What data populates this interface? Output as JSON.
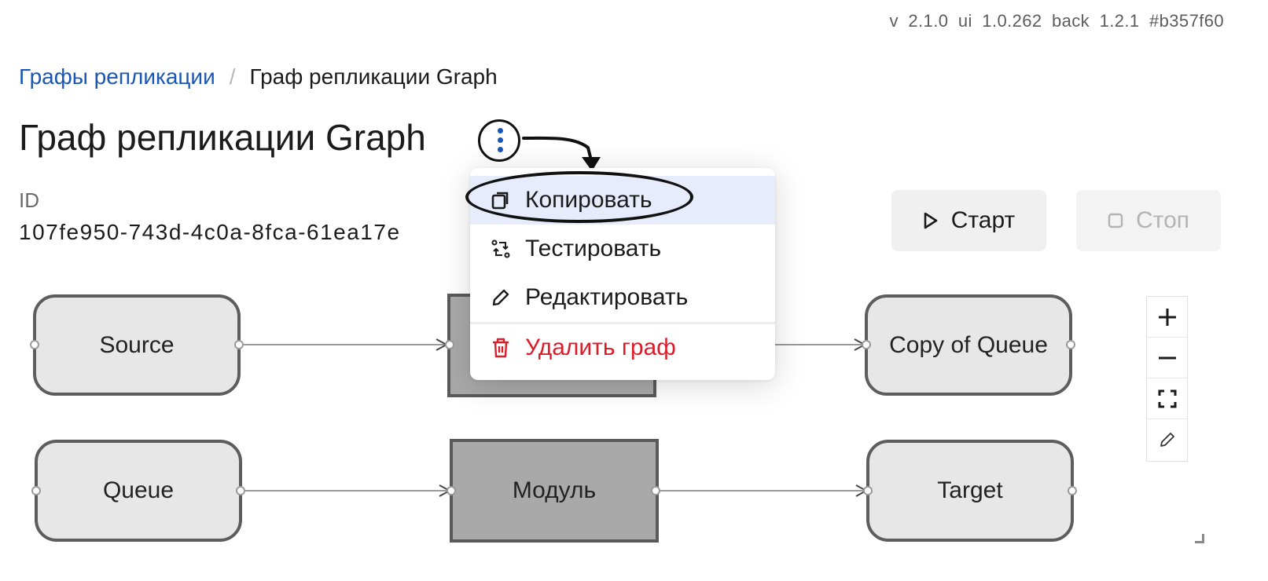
{
  "version_info": "v 2.1.0  ui 1.0.262  back 1.2.1  #b357f60",
  "breadcrumb": {
    "parent": "Графы репликации",
    "separator": "/",
    "current": "Граф репликации Graph"
  },
  "page_title": "Граф репликации Graph",
  "id_label": "ID",
  "id_value": "107fe950-743d-4c0a-8fca-61ea17e",
  "buttons": {
    "start": "Старт",
    "stop": "Стоп"
  },
  "menu": {
    "items": [
      {
        "label": "Копировать",
        "icon": "copy-icon",
        "state": "hovered"
      },
      {
        "label": "Тестировать",
        "icon": "test-icon"
      },
      {
        "label": "Редактировать",
        "icon": "pencil-icon"
      },
      {
        "label": "Удалить граф",
        "icon": "trash-icon",
        "color": "#dc1c28"
      }
    ]
  },
  "graph": {
    "nodes": {
      "source": "Source",
      "queue": "Queue",
      "module": "Модуль",
      "copy_of_queue": "Copy of Queue",
      "target": "Target"
    }
  },
  "zoom_controls": [
    "zoom-in-icon",
    "zoom-out-icon",
    "fit-view-icon",
    "edit-icon"
  ],
  "colors": {
    "link": "#1a56b5",
    "danger": "#dc1c28",
    "menu_active_bg": "#e6ecfb",
    "node_fill": "#e7e7e7",
    "module_fill": "#a9a9a9"
  }
}
